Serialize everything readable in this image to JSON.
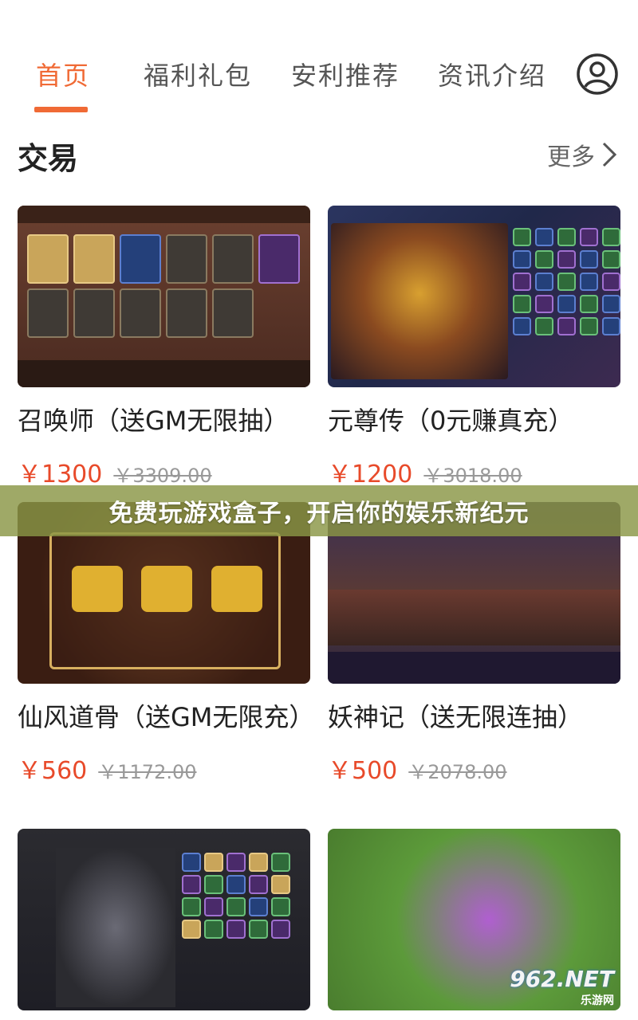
{
  "nav": {
    "tabs": [
      {
        "label": "首页",
        "active": true
      },
      {
        "label": "福利礼包",
        "active": false
      },
      {
        "label": "安利推荐",
        "active": false
      },
      {
        "label": "资讯介绍",
        "active": false
      }
    ],
    "user_icon": "user-circle-icon"
  },
  "section": {
    "title": "交易",
    "more_label": "更多"
  },
  "cards": [
    {
      "title": "召唤师（送GM无限抽）",
      "price": "￥1300",
      "original": "￥3309.00"
    },
    {
      "title": "元尊传（0元赚真充）",
      "price": "￥1200",
      "original": "￥3018.00"
    },
    {
      "title": "仙风道骨（送GM无限充）",
      "price": "￥560",
      "original": "￥1172.00"
    },
    {
      "title": "妖神记（送无限连抽）",
      "price": "￥500",
      "original": "￥2078.00"
    },
    {
      "title": "",
      "price": "",
      "original": ""
    },
    {
      "title": "",
      "price": "",
      "original": ""
    }
  ],
  "banner": {
    "text": "免费玩游戏盒子，开启你的娱乐新纪元"
  },
  "watermark": {
    "big": "962.NET",
    "small": "乐游网"
  },
  "colors": {
    "accent": "#f06a35",
    "price": "#e84a2a",
    "banner": "#8a9646"
  }
}
